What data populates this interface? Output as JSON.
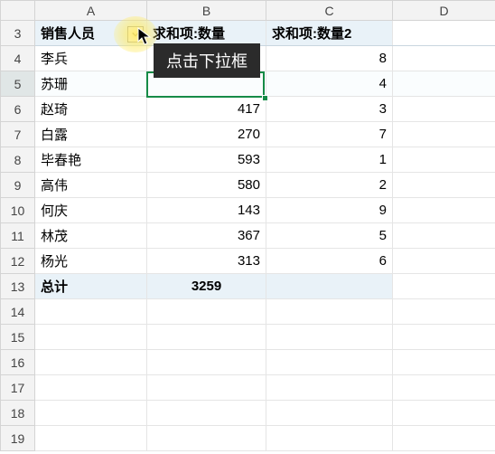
{
  "columns": {
    "A": "A",
    "B": "B",
    "C": "C",
    "D": "D"
  },
  "header": {
    "col_a": "销售人员",
    "col_b": "求和项:数量",
    "col_c": "求和项:数量2"
  },
  "rows": [
    {
      "r": "3"
    },
    {
      "r": "4",
      "a": "李兵",
      "b": "",
      "c": "8"
    },
    {
      "r": "5",
      "a": "苏珊",
      "b": "",
      "c": "4"
    },
    {
      "r": "6",
      "a": "赵琦",
      "b": "417",
      "c": "3"
    },
    {
      "r": "7",
      "a": "白露",
      "b": "270",
      "c": "7"
    },
    {
      "r": "8",
      "a": "毕春艳",
      "b": "593",
      "c": "1"
    },
    {
      "r": "9",
      "a": "高伟",
      "b": "580",
      "c": "2"
    },
    {
      "r": "10",
      "a": "何庆",
      "b": "143",
      "c": "9"
    },
    {
      "r": "11",
      "a": "林茂",
      "b": "367",
      "c": "5"
    },
    {
      "r": "12",
      "a": "杨光",
      "b": "313",
      "c": "6"
    },
    {
      "r": "13",
      "a": "总计",
      "b": "3259",
      "c": ""
    },
    {
      "r": "14"
    },
    {
      "r": "15"
    },
    {
      "r": "16"
    },
    {
      "r": "17"
    },
    {
      "r": "18"
    },
    {
      "r": "19"
    }
  ],
  "tooltip_text": "点击下拉框",
  "active_cell": "B5",
  "dropdown_icon": "filter-dropdown"
}
